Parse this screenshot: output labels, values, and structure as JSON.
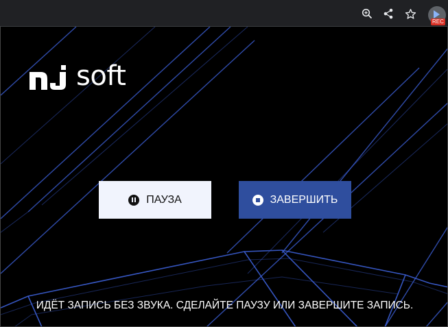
{
  "toolbar": {
    "icons": [
      "zoom-icon",
      "share-icon",
      "star-icon",
      "screen-recorder-extension-icon"
    ],
    "rec_badge": "REC"
  },
  "logo": {
    "text": "soft"
  },
  "buttons": {
    "pause_label": "ПАУЗА",
    "stop_label": "ЗАВЕРШИТЬ"
  },
  "status_message": "ИДЁТ ЗАПИСЬ БЕЗ ЗВУКА. СДЕЛАЙТЕ ПАУЗУ ИЛИ ЗАВЕРШИТЕ ЗАПИСЬ.",
  "colors": {
    "background": "#000000",
    "line_accent": "#3c5fd6",
    "pause_button": "#f1f4fd",
    "stop_button": "#2f4e9e"
  }
}
